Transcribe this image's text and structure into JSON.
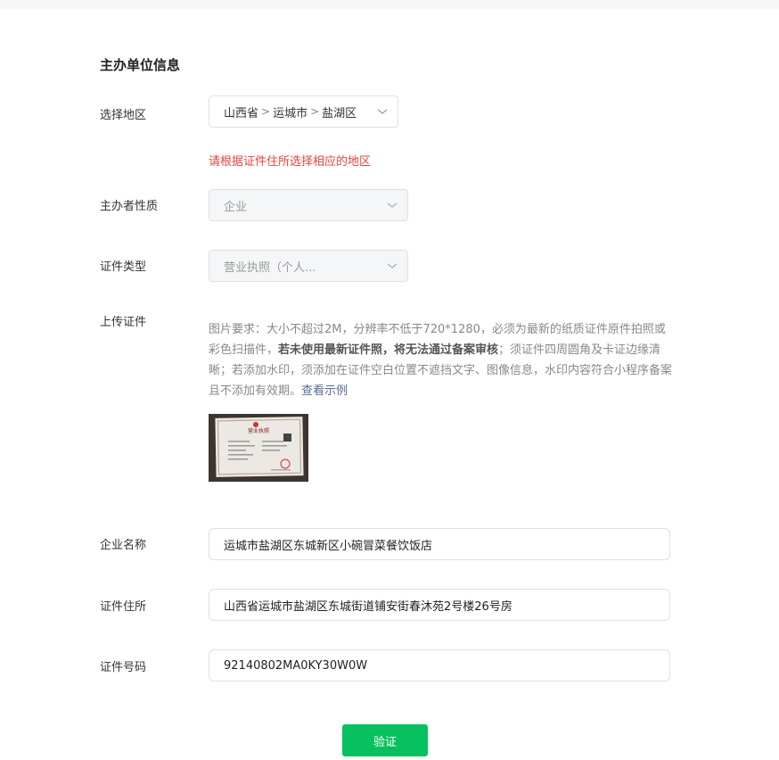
{
  "section": {
    "title": "主办单位信息"
  },
  "region": {
    "label": "选择地区",
    "province": "山西省",
    "city": "运城市",
    "district": "盐湖区",
    "hint": "请根据证件住所选择相应的地区"
  },
  "nature": {
    "label": "主办者性质",
    "value": "企业"
  },
  "cert_type": {
    "label": "证件类型",
    "value": "营业执照（个人..."
  },
  "upload": {
    "label": "上传证件",
    "desc_part1": "图片要求：大小不超过2M，分辨率不低于720*1280，必须为最新的纸质证件原件拍照或彩色扫描件，",
    "desc_bold": "若未使用最新证件照，将无法通过备案审核",
    "desc_part2": "；须证件四周圆角及卡证边缘清晰；若添加水印，须添加在证件空白位置不遮挡文字、图像信息，水印内容符合小程序备案且不添加有效期。",
    "example_link": "查看示例",
    "thumb_title": "营业执照"
  },
  "company_name": {
    "label": "企业名称",
    "value": "运城市盐湖区东城新区小碗冒菜餐饮饭店"
  },
  "cert_address": {
    "label": "证件住所",
    "value": "山西省运城市盐湖区东城街道铺安街春沐苑2号楼26号房"
  },
  "cert_number": {
    "label": "证件号码",
    "value": "92140802MA0KY30W0W"
  },
  "submit": {
    "label": "验证"
  },
  "colors": {
    "accent": "#07c160",
    "error": "#e64340",
    "link": "#576b95"
  },
  "icons": {
    "dropdown": "chevron-down-icon",
    "separator": "chevron-right-icon"
  }
}
